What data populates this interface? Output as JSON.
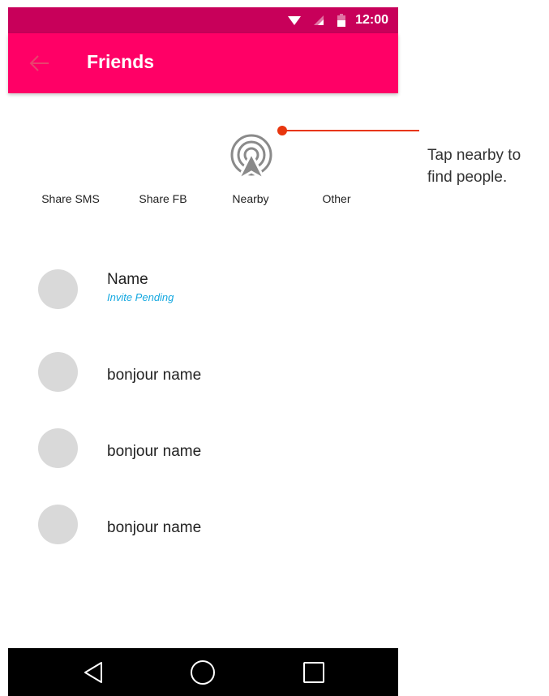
{
  "status_bar": {
    "time": "12:00",
    "icons": [
      "wifi-icon",
      "signal-icon",
      "battery-icon"
    ],
    "background": "#c8005a"
  },
  "app_bar": {
    "title": "Friends",
    "back_icon": "arrow-left-icon",
    "background": "#ff0066"
  },
  "share_options": [
    {
      "label": "Share SMS"
    },
    {
      "label": "Share FB"
    },
    {
      "label": "Nearby",
      "icon": "nearby-broadcast-icon"
    },
    {
      "label": "Other"
    }
  ],
  "callout": {
    "text": "Tap nearby to find people.",
    "color": "#e8360e"
  },
  "friends": [
    {
      "name": "Name",
      "status": "Invite Pending"
    },
    {
      "name": "bonjour name"
    },
    {
      "name": "bonjour name"
    },
    {
      "name": "bonjour name"
    }
  ],
  "nav_bar": {
    "buttons": [
      "back-triangle-icon",
      "home-circle-icon",
      "recents-square-icon"
    ]
  },
  "colors": {
    "accent": "#ff0066",
    "status_text": "#14a8e0",
    "avatar": "#d9d9d9"
  }
}
